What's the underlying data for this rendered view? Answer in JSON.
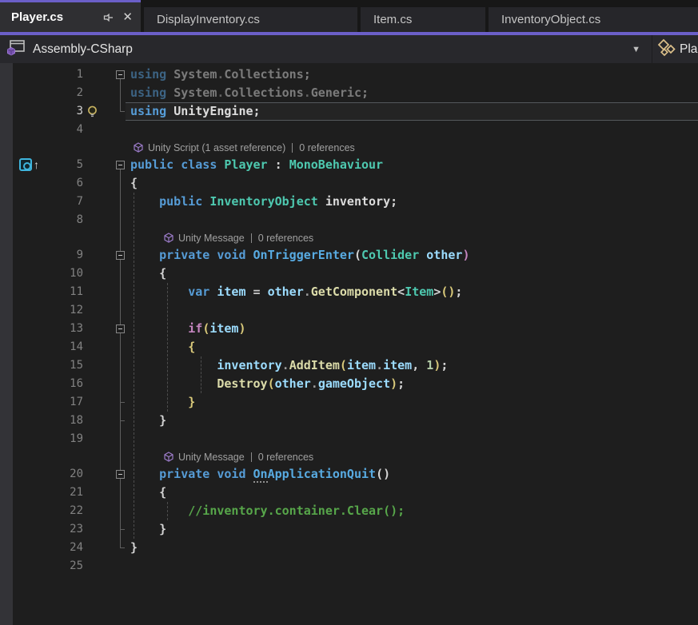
{
  "tabs": [
    {
      "label": "Player.cs",
      "active": true,
      "pinned": true
    },
    {
      "label": "DisplayInventory.cs",
      "active": false
    },
    {
      "label": "Item.cs",
      "active": false
    },
    {
      "label": "InventoryObject.cs",
      "active": false
    }
  ],
  "navbar": {
    "project": "Assembly-CSharp",
    "scope": "Pla",
    "project_icon": "assembly-icon",
    "scope_icon": "class-icon"
  },
  "palette": {
    "accent_purple": "#6B5FC8",
    "editor_bg": "#1E1E1E",
    "keyword": "#569CD6",
    "control_keyword": "#C586C0",
    "type": "#4EC9B0",
    "method": "#DCDCAA",
    "unity_message": "#58ABE2",
    "variable": "#9CDCFE",
    "number": "#B5CEA8",
    "comment": "#57A64A",
    "gold_bracket": "#D9C97A",
    "codelens_text": "#A0A0A0",
    "line_number": "#828282"
  },
  "editor": {
    "rows": [
      {
        "t": "code",
        "n": 1,
        "fold": 1,
        "dim": 1,
        "tok": [
          [
            "using",
            "kw"
          ],
          [
            " ",
            "sp"
          ],
          [
            "System",
            "id"
          ],
          [
            ".",
            "dot"
          ],
          [
            "Collections",
            "id"
          ],
          [
            ";",
            "pun"
          ]
        ]
      },
      {
        "t": "code",
        "n": 2,
        "dim": 1,
        "tok": [
          [
            "using",
            "kw"
          ],
          [
            " ",
            "sp"
          ],
          [
            "System",
            "id"
          ],
          [
            ".",
            "dot"
          ],
          [
            "Collections",
            "id"
          ],
          [
            ".",
            "dot"
          ],
          [
            "Generic",
            "id"
          ],
          [
            ";",
            "pun"
          ]
        ]
      },
      {
        "t": "code",
        "n": 3,
        "cur": 1,
        "bulb": 1,
        "tok": [
          [
            "using",
            "kw"
          ],
          [
            " ",
            "sp"
          ],
          [
            "UnityEngine",
            "idb"
          ],
          [
            ";",
            "pun"
          ]
        ]
      },
      {
        "t": "code",
        "n": 4,
        "tok": []
      },
      {
        "t": "lens",
        "ind": 0,
        "icon": "unity-cube-icon",
        "text": "Unity Script (1 asset reference)",
        "refs": "0 references"
      },
      {
        "t": "code",
        "n": 5,
        "fold": 1,
        "glyph": 1,
        "tok": [
          [
            "public",
            "kw"
          ],
          [
            " ",
            "sp"
          ],
          [
            "class",
            "kw"
          ],
          [
            " ",
            "sp"
          ],
          [
            "Player",
            "type"
          ],
          [
            " : ",
            "pun"
          ],
          [
            "MonoBehaviour",
            "type"
          ]
        ]
      },
      {
        "t": "code",
        "n": 6,
        "tok": [
          [
            "{",
            "pun"
          ]
        ]
      },
      {
        "t": "code",
        "n": 7,
        "tok": [
          [
            "    ",
            "sp"
          ],
          [
            "public",
            "kw"
          ],
          [
            " ",
            "sp"
          ],
          [
            "InventoryObject",
            "type"
          ],
          [
            " ",
            "sp"
          ],
          [
            "inventory",
            "idb"
          ],
          [
            ";",
            "pun"
          ]
        ]
      },
      {
        "t": "code",
        "n": 8,
        "tok": []
      },
      {
        "t": "lens",
        "ind": 1,
        "icon": "unity-cube-icon",
        "text": "Unity Message",
        "refs": "0 references"
      },
      {
        "t": "code",
        "n": 9,
        "fold": 1,
        "tok": [
          [
            "    ",
            "sp"
          ],
          [
            "private",
            "kw"
          ],
          [
            " ",
            "sp"
          ],
          [
            "void",
            "kw"
          ],
          [
            " ",
            "sp"
          ],
          [
            "OnTriggerEnter",
            "um"
          ],
          [
            "(",
            "pun"
          ],
          [
            "Collider",
            "type"
          ],
          [
            " ",
            "sp"
          ],
          [
            "other",
            "var"
          ],
          [
            ")",
            "pur"
          ]
        ]
      },
      {
        "t": "code",
        "n": 10,
        "tok": [
          [
            "    ",
            "sp"
          ],
          [
            "{",
            "pun"
          ]
        ]
      },
      {
        "t": "code",
        "n": 11,
        "tok": [
          [
            "        ",
            "sp"
          ],
          [
            "var",
            "kw"
          ],
          [
            " ",
            "sp"
          ],
          [
            "item",
            "var"
          ],
          [
            " ",
            "sp"
          ],
          [
            "=",
            "op"
          ],
          [
            " ",
            "sp"
          ],
          [
            "other",
            "var"
          ],
          [
            ".",
            "dot"
          ],
          [
            "GetComponent",
            "method"
          ],
          [
            "<",
            "pun"
          ],
          [
            "Item",
            "type"
          ],
          [
            ">",
            "pun"
          ],
          [
            "(",
            "gold"
          ],
          [
            ")",
            "gold"
          ],
          [
            ";",
            "pun"
          ]
        ]
      },
      {
        "t": "code",
        "n": 12,
        "tok": []
      },
      {
        "t": "code",
        "n": 13,
        "fold": 1,
        "tok": [
          [
            "        ",
            "sp"
          ],
          [
            "if",
            "ctrl"
          ],
          [
            "(",
            "gold"
          ],
          [
            "item",
            "var"
          ],
          [
            ")",
            "gold"
          ]
        ]
      },
      {
        "t": "code",
        "n": 14,
        "tok": [
          [
            "        ",
            "sp"
          ],
          [
            "{",
            "gold"
          ]
        ]
      },
      {
        "t": "code",
        "n": 15,
        "tok": [
          [
            "            ",
            "sp"
          ],
          [
            "inventory",
            "var"
          ],
          [
            ".",
            "dot"
          ],
          [
            "AddItem",
            "method"
          ],
          [
            "(",
            "gold"
          ],
          [
            "item",
            "var"
          ],
          [
            ".",
            "dot"
          ],
          [
            "item",
            "var"
          ],
          [
            ",",
            "pun"
          ],
          [
            " ",
            "sp"
          ],
          [
            "1",
            "num"
          ],
          [
            ")",
            "gold"
          ],
          [
            ";",
            "pun"
          ]
        ]
      },
      {
        "t": "code",
        "n": 16,
        "tok": [
          [
            "            ",
            "sp"
          ],
          [
            "Destroy",
            "method"
          ],
          [
            "(",
            "gold"
          ],
          [
            "other",
            "var"
          ],
          [
            ".",
            "dot"
          ],
          [
            "gameObject",
            "var"
          ],
          [
            ")",
            "gold"
          ],
          [
            ";",
            "pun"
          ]
        ]
      },
      {
        "t": "code",
        "n": 17,
        "tok": [
          [
            "        ",
            "sp"
          ],
          [
            "}",
            "gold"
          ]
        ]
      },
      {
        "t": "code",
        "n": 18,
        "tok": [
          [
            "    ",
            "sp"
          ],
          [
            "}",
            "pun"
          ]
        ]
      },
      {
        "t": "code",
        "n": 19,
        "tok": []
      },
      {
        "t": "lens",
        "ind": 1,
        "icon": "unity-cube-icon",
        "text": "Unity Message",
        "refs": "0 references"
      },
      {
        "t": "code",
        "n": 20,
        "fold": 1,
        "tok": [
          [
            "    ",
            "sp"
          ],
          [
            "private",
            "kw"
          ],
          [
            " ",
            "sp"
          ],
          [
            "void",
            "kw"
          ],
          [
            " ",
            "sp"
          ],
          [
            "On",
            "umdots"
          ],
          [
            "ApplicationQuit",
            "um"
          ],
          [
            "()",
            "pun"
          ]
        ]
      },
      {
        "t": "code",
        "n": 21,
        "tok": [
          [
            "    ",
            "sp"
          ],
          [
            "{",
            "pun"
          ]
        ]
      },
      {
        "t": "code",
        "n": 22,
        "tok": [
          [
            "        ",
            "sp"
          ],
          [
            "//inventory.container.Clear();",
            "cmt"
          ]
        ]
      },
      {
        "t": "code",
        "n": 23,
        "tok": [
          [
            "    ",
            "sp"
          ],
          [
            "}",
            "pun"
          ]
        ]
      },
      {
        "t": "code",
        "n": 24,
        "tok": [
          [
            "}",
            "pun"
          ]
        ]
      },
      {
        "t": "code",
        "n": 25,
        "tok": []
      }
    ]
  }
}
